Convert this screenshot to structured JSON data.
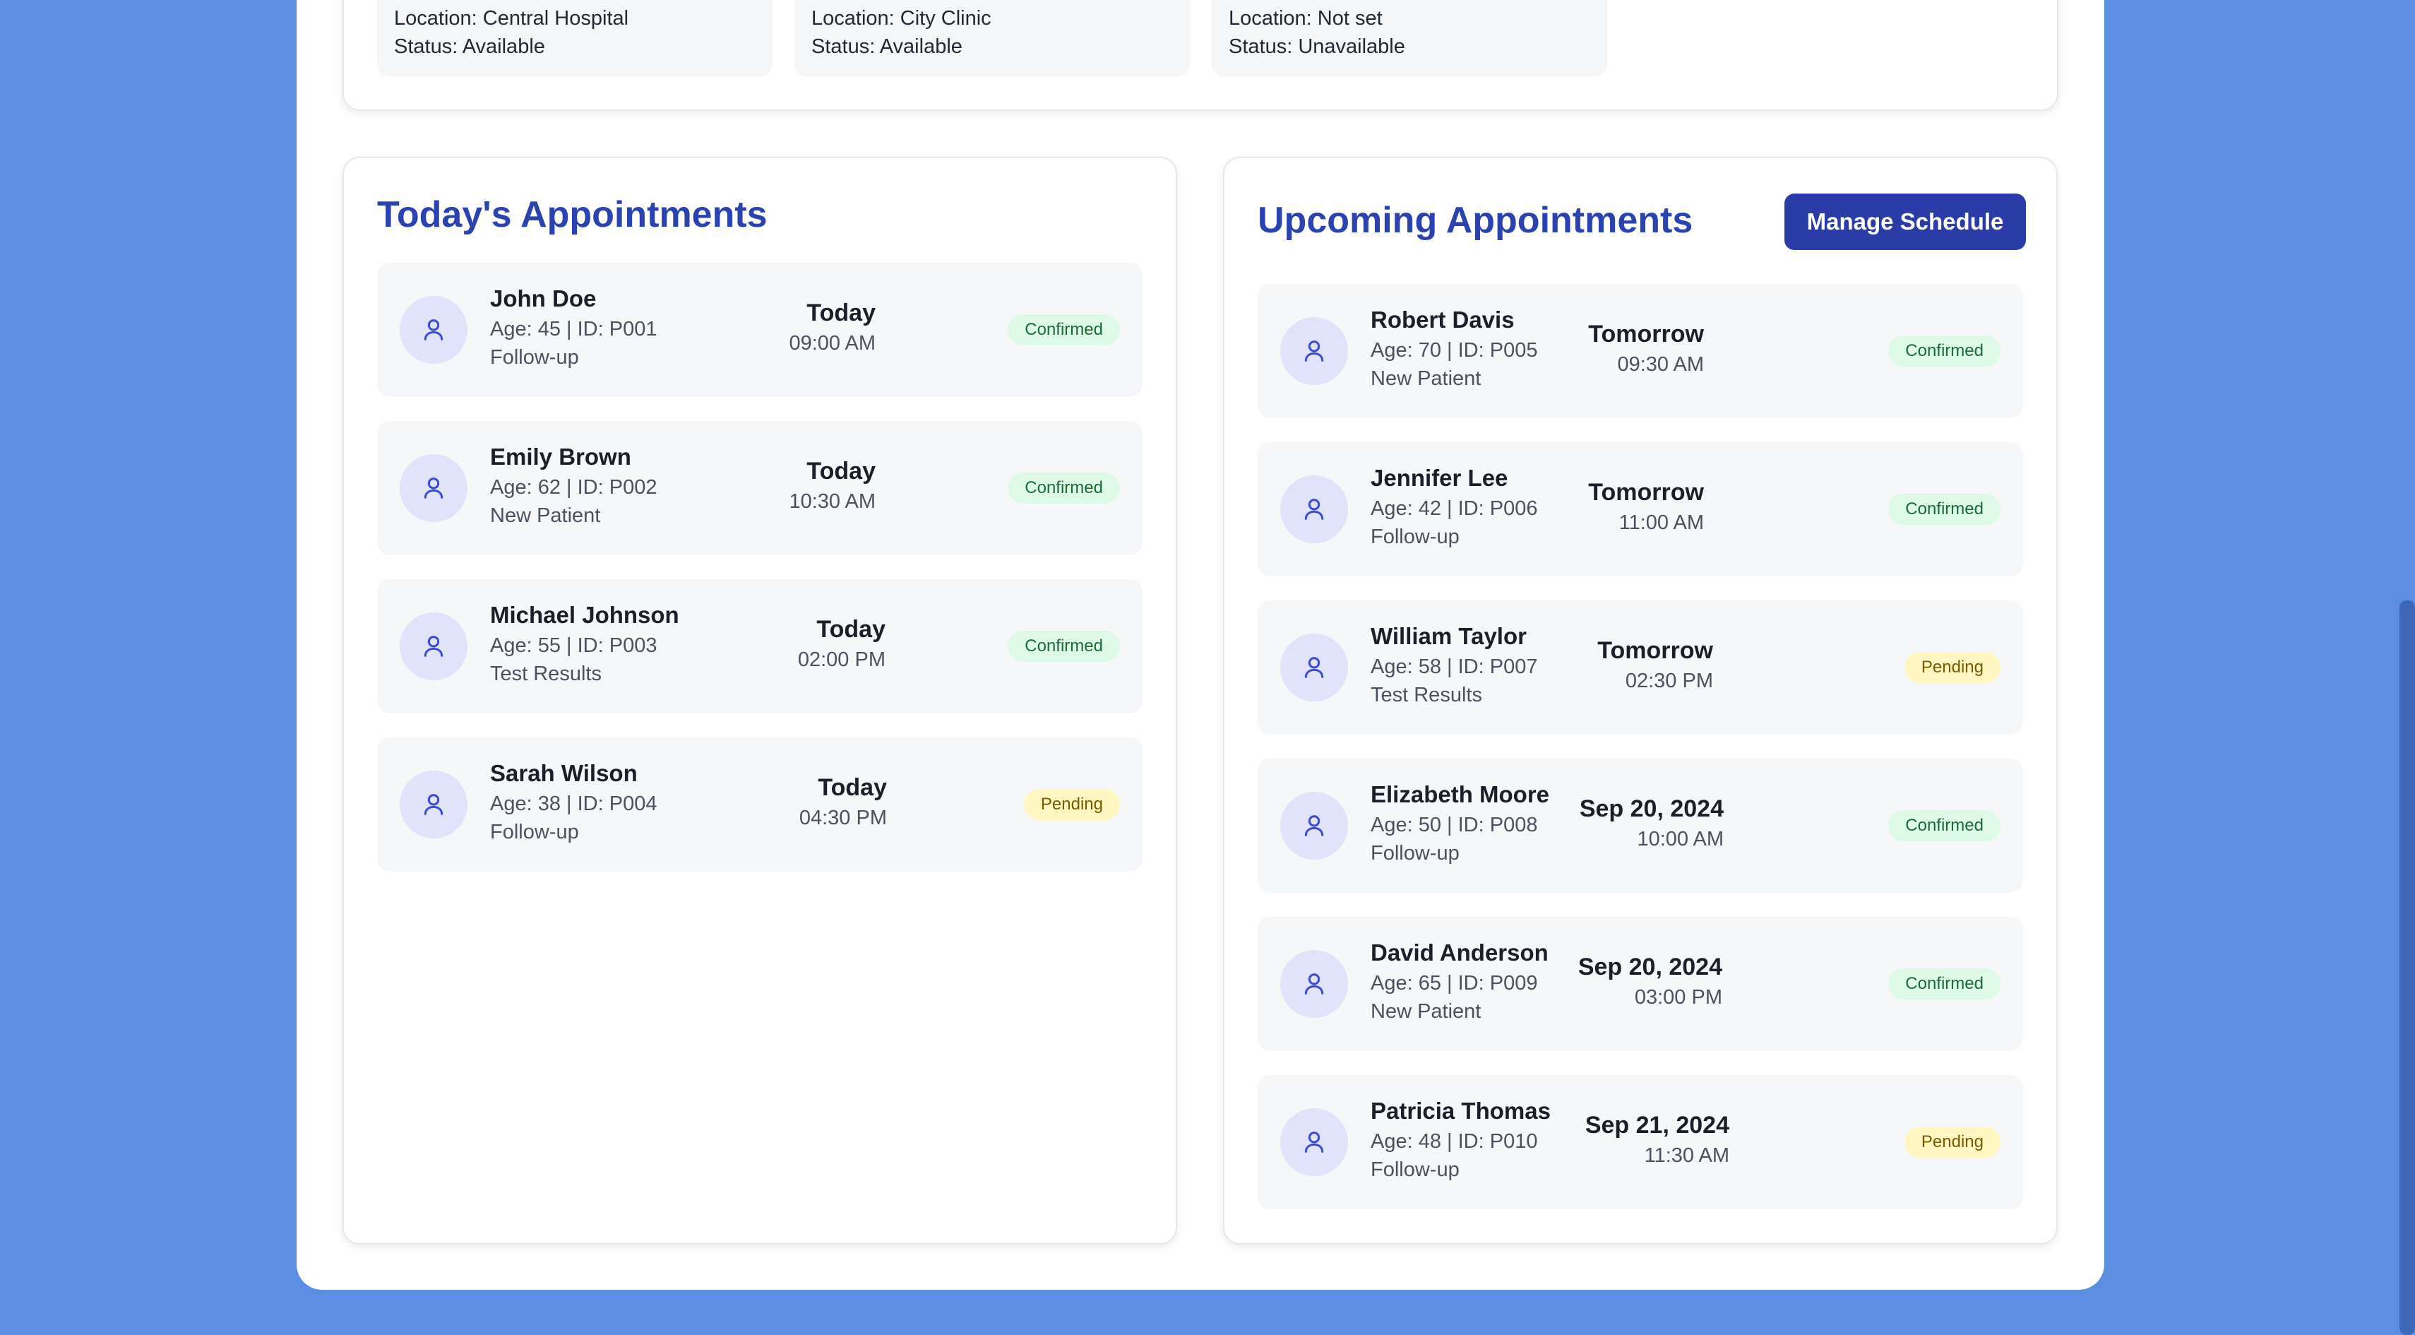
{
  "locations": [
    {
      "location": "Location: Central Hospital",
      "status": "Status: Available"
    },
    {
      "location": "Location: City Clinic",
      "status": "Status: Available"
    },
    {
      "location": "Location: Not set",
      "status": "Status: Unavailable"
    }
  ],
  "today": {
    "title": "Today's Appointments",
    "items": [
      {
        "name": "John Doe",
        "meta": "Age: 45 | ID: P001",
        "type": "Follow-up",
        "day": "Today",
        "time": "09:00 AM",
        "status": "Confirmed",
        "status_kind": "confirmed"
      },
      {
        "name": "Emily Brown",
        "meta": "Age: 62 | ID: P002",
        "type": "New Patient",
        "day": "Today",
        "time": "10:30 AM",
        "status": "Confirmed",
        "status_kind": "confirmed"
      },
      {
        "name": "Michael Johnson",
        "meta": "Age: 55 | ID: P003",
        "type": "Test Results",
        "day": "Today",
        "time": "02:00 PM",
        "status": "Confirmed",
        "status_kind": "confirmed"
      },
      {
        "name": "Sarah Wilson",
        "meta": "Age: 38 | ID: P004",
        "type": "Follow-up",
        "day": "Today",
        "time": "04:30 PM",
        "status": "Pending",
        "status_kind": "pending"
      }
    ]
  },
  "upcoming": {
    "title": "Upcoming Appointments",
    "manage_label": "Manage Schedule",
    "items": [
      {
        "name": "Robert Davis",
        "meta": "Age: 70 | ID: P005",
        "type": "New Patient",
        "day": "Tomorrow",
        "time": "09:30 AM",
        "status": "Confirmed",
        "status_kind": "confirmed"
      },
      {
        "name": "Jennifer Lee",
        "meta": "Age: 42 | ID: P006",
        "type": "Follow-up",
        "day": "Tomorrow",
        "time": "11:00 AM",
        "status": "Confirmed",
        "status_kind": "confirmed"
      },
      {
        "name": "William Taylor",
        "meta": "Age: 58 | ID: P007",
        "type": "Test Results",
        "day": "Tomorrow",
        "time": "02:30 PM",
        "status": "Pending",
        "status_kind": "pending"
      },
      {
        "name": "Elizabeth Moore",
        "meta": "Age: 50 | ID: P008",
        "type": "Follow-up",
        "day": "Sep 20, 2024",
        "time": "10:00 AM",
        "status": "Confirmed",
        "status_kind": "confirmed"
      },
      {
        "name": "David Anderson",
        "meta": "Age: 65 | ID: P009",
        "type": "New Patient",
        "day": "Sep 20, 2024",
        "time": "03:00 PM",
        "status": "Confirmed",
        "status_kind": "confirmed"
      },
      {
        "name": "Patricia Thomas",
        "meta": "Age: 48 | ID: P010",
        "type": "Follow-up",
        "day": "Sep 21, 2024",
        "time": "11:30 AM",
        "status": "Pending",
        "status_kind": "pending"
      }
    ]
  },
  "colors": {
    "background": "#5b8de3",
    "accent": "#2a43b0",
    "button": "#2a3ca8",
    "confirmed_bg": "#dcfae6",
    "pending_bg": "#fff6c2"
  },
  "icons": {
    "avatar": "user-icon"
  }
}
